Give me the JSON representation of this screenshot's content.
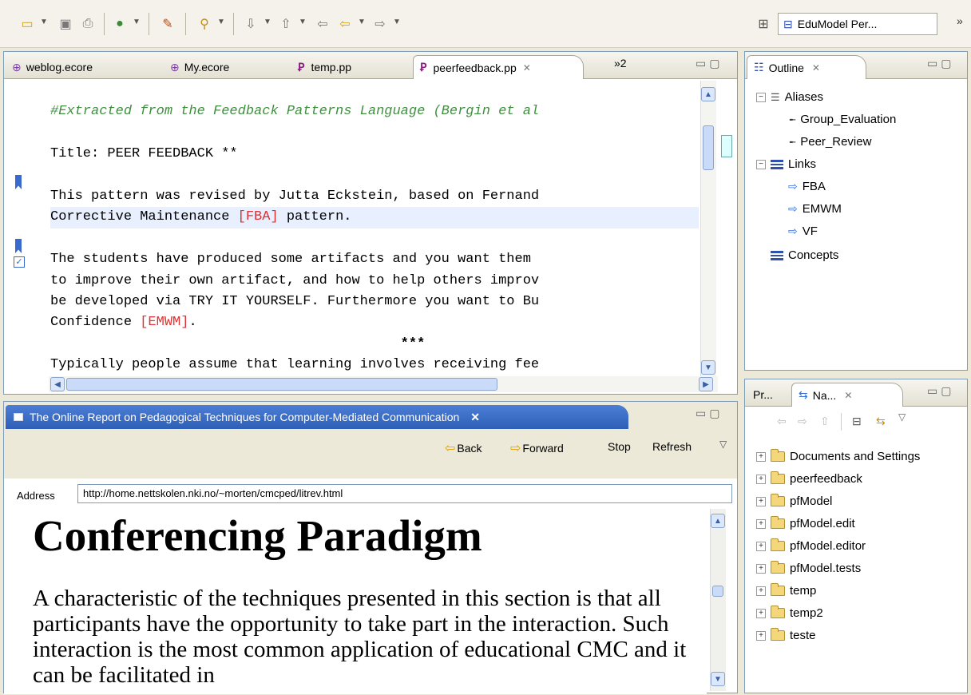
{
  "toolbar": {
    "perspective_label": "EduModel Per...",
    "overflow": "»"
  },
  "editor": {
    "tabs": [
      {
        "label": "weblog.ecore"
      },
      {
        "label": "My.ecore"
      },
      {
        "label": "temp.pp"
      },
      {
        "label": "peerfeedback.pp",
        "active": true
      }
    ],
    "more_tabs": "»2",
    "lines": {
      "l1": "#Extracted from the Feedback Patterns Language (Bergin et al",
      "l2": "",
      "l3": "Title: PEER FEEDBACK **",
      "l4": "",
      "l5": "This pattern was revised by Jutta Eckstein, based on Fernand",
      "l6a": "Corrective Maintenance ",
      "l6b": "[FBA]",
      "l6c": " pattern.",
      "l7": "",
      "l8": "The students have produced some artifacts and you want them ",
      "l9": "to improve their own artifact, and how to help others improv",
      "l10": "be developed via TRY IT YOURSELF. Furthermore you want to Bu",
      "l11a": "Confidence ",
      "l11b": "[EMWM]",
      "l11c": ".",
      "l12": "                                           ***",
      "l13": "Typically people assume that learning involves receiving fee"
    }
  },
  "browser": {
    "title": "The Online Report on Pedagogical Techniques for Computer-Mediated Communication",
    "nav": {
      "back": "Back",
      "forward": "Forward",
      "stop": "Stop",
      "refresh": "Refresh"
    },
    "address_label": "Address",
    "address_value": "http://home.nettskolen.nki.no/~morten/cmcped/litrev.html",
    "heading": "Conferencing Paradigm",
    "paragraph": "A characteristic of the techniques presented in this section is that all participants have the opportunity to take part in the interaction. Such interaction is the most common application of educational CMC and it can be facilitated in"
  },
  "outline": {
    "tab_label": "Outline",
    "items": [
      {
        "label": "Aliases"
      },
      {
        "label": "Group_Evaluation"
      },
      {
        "label": "Peer_Review"
      },
      {
        "label": "Links"
      },
      {
        "label": "FBA"
      },
      {
        "label": "EMWM"
      },
      {
        "label": "VF"
      },
      {
        "label": "Concepts"
      }
    ]
  },
  "navigator": {
    "tab_pr": "Pr...",
    "tab_na": "Na...",
    "items": [
      {
        "label": "Documents and Settings"
      },
      {
        "label": "peerfeedback"
      },
      {
        "label": "pfModel"
      },
      {
        "label": "pfModel.edit"
      },
      {
        "label": "pfModel.editor"
      },
      {
        "label": "pfModel.tests"
      },
      {
        "label": "temp"
      },
      {
        "label": "temp2"
      },
      {
        "label": "teste"
      }
    ]
  }
}
